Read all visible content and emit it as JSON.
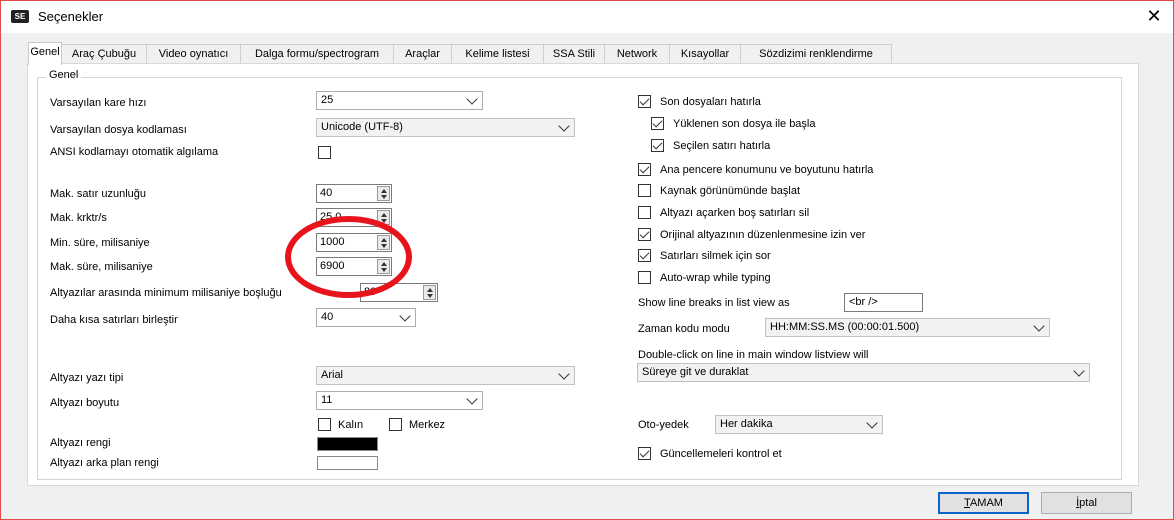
{
  "window": {
    "title": "Seçenekler",
    "icon_text": "SE",
    "close": "✕"
  },
  "tabs": [
    "Genel",
    "Araç Çubuğu",
    "Video oynatıcı",
    "Dalga formu/spectrogram",
    "Araçlar",
    "Kelime listesi",
    "SSA Stili",
    "Network",
    "Kısayollar",
    "Sözdizimi renklendirme"
  ],
  "group_title": "Genel",
  "left": {
    "frame_rate": {
      "label": "Varsayılan kare hızı",
      "value": "25"
    },
    "encoding": {
      "label": "Varsayılan dosya kodlaması",
      "value": "Unicode (UTF-8)"
    },
    "ansi": {
      "label": "ANSI kodlamayı otomatik algılama",
      "checked": false
    },
    "max_line": {
      "label": "Mak. satır uzunluğu",
      "value": "40"
    },
    "max_cps": {
      "label": "Mak. krktr/s",
      "value": "25,0"
    },
    "min_dur": {
      "label": "Min. süre, milisaniye",
      "value": "1000"
    },
    "max_dur": {
      "label": "Mak. süre, milisaniye",
      "value": "6900"
    },
    "min_gap": {
      "label": "Altyazılar arasında minimum milisaniye boşluğu",
      "value": "80"
    },
    "merge_short": {
      "label": "Daha kısa satırları birleştir",
      "value": "40"
    },
    "font": {
      "label": "Altyazı yazı tipi",
      "value": "Arial"
    },
    "font_size": {
      "label": "Altyazı boyutu",
      "value": "11"
    },
    "bold": {
      "label": "Kalın",
      "checked": false
    },
    "center": {
      "label": "Merkez",
      "checked": false
    },
    "color": {
      "label": "Altyazı rengi",
      "value": "#000000"
    },
    "bg_color": {
      "label": "Altyazı arka plan rengi",
      "value": "#ffffff"
    }
  },
  "right": {
    "remember_files": {
      "label": "Son dosyaları hatırla",
      "checked": true
    },
    "start_last": {
      "label": "Yüklenen son dosya ile başla",
      "checked": true
    },
    "remember_line": {
      "label": "Seçilen satırı hatırla",
      "checked": true
    },
    "remember_window": {
      "label": "Ana pencere konumunu ve boyutunu hatırla",
      "checked": true
    },
    "source_view": {
      "label": "Kaynak görünümünde başlat",
      "checked": false
    },
    "remove_blank": {
      "label": "Altyazı açarken boş satırları sil",
      "checked": false
    },
    "allow_edit": {
      "label": "Orijinal altyazının düzenlenmesine izin ver",
      "checked": true
    },
    "prompt_delete": {
      "label": "Satırları silmek için sor",
      "checked": true
    },
    "autowrap": {
      "label": "Auto-wrap while typing",
      "checked": false
    },
    "line_breaks": {
      "label": "Show line breaks in list view as",
      "value": "<br />"
    },
    "timecode": {
      "label": "Zaman kodu modu",
      "value": "HH:MM:SS.MS (00:00:01.500)"
    },
    "dblclick": {
      "label": "Double-click on line in main window listview will",
      "value": "Süreye git ve duraklat"
    },
    "autobackup": {
      "label": "Oto-yedek",
      "value": "Her dakika"
    },
    "check_updates": {
      "label": "Güncellemeleri kontrol et",
      "checked": true
    }
  },
  "buttons": {
    "ok_accel": "T",
    "ok_rest": "AMAM",
    "cancel_accel": "İ",
    "cancel_rest": "ptal"
  },
  "colors": {
    "annotation": "#e8141b",
    "default_button": "#0a64c8"
  }
}
